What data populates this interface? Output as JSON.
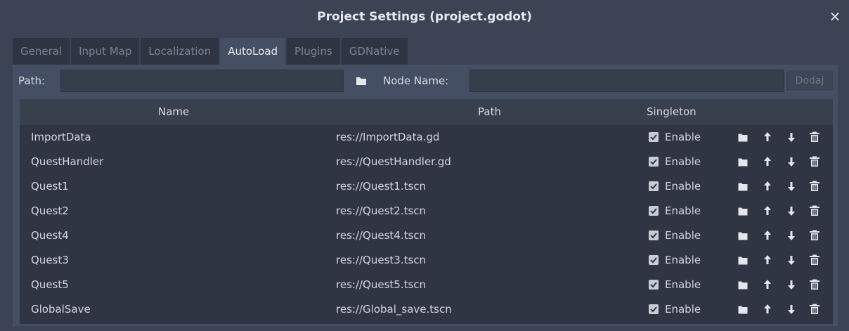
{
  "window": {
    "title": "Project Settings (project.godot)",
    "close_glyph": "×"
  },
  "tabs": [
    {
      "label": "General"
    },
    {
      "label": "Input Map"
    },
    {
      "label": "Localization"
    },
    {
      "label": "AutoLoad",
      "active": true
    },
    {
      "label": "Plugins"
    },
    {
      "label": "GDNative"
    }
  ],
  "autoload": {
    "path_label": "Path:",
    "path_value": "",
    "node_name_label": "Node Name:",
    "node_name_value": "",
    "add_label": "Dodaj",
    "browse_icon": "folder-icon"
  },
  "table": {
    "headers": {
      "name": "Name",
      "path": "Path",
      "singleton": "Singleton"
    },
    "enable_label": "Enable",
    "rows": [
      {
        "name": "ImportData",
        "path": "res://ImportData.gd",
        "enabled": true
      },
      {
        "name": "QuestHandler",
        "path": "res://QuestHandler.gd",
        "enabled": true
      },
      {
        "name": "Quest1",
        "path": "res://Quest1.tscn",
        "enabled": true
      },
      {
        "name": "Quest2",
        "path": "res://Quest2.tscn",
        "enabled": true
      },
      {
        "name": "Quest4",
        "path": "res://Quest4.tscn",
        "enabled": true
      },
      {
        "name": "Quest3",
        "path": "res://Quest3.tscn",
        "enabled": true
      },
      {
        "name": "Quest5",
        "path": "res://Quest5.tscn",
        "enabled": true
      },
      {
        "name": "GlobalSave",
        "path": "res://Global_save.tscn",
        "enabled": true
      }
    ],
    "row_action_icons": [
      "folder-icon",
      "arrow-up-icon",
      "arrow-down-icon",
      "trash-icon"
    ]
  },
  "colors": {
    "background": "#3b4354",
    "panel": "#454f63",
    "list": "#2f3542",
    "text": "#d6d9df"
  }
}
